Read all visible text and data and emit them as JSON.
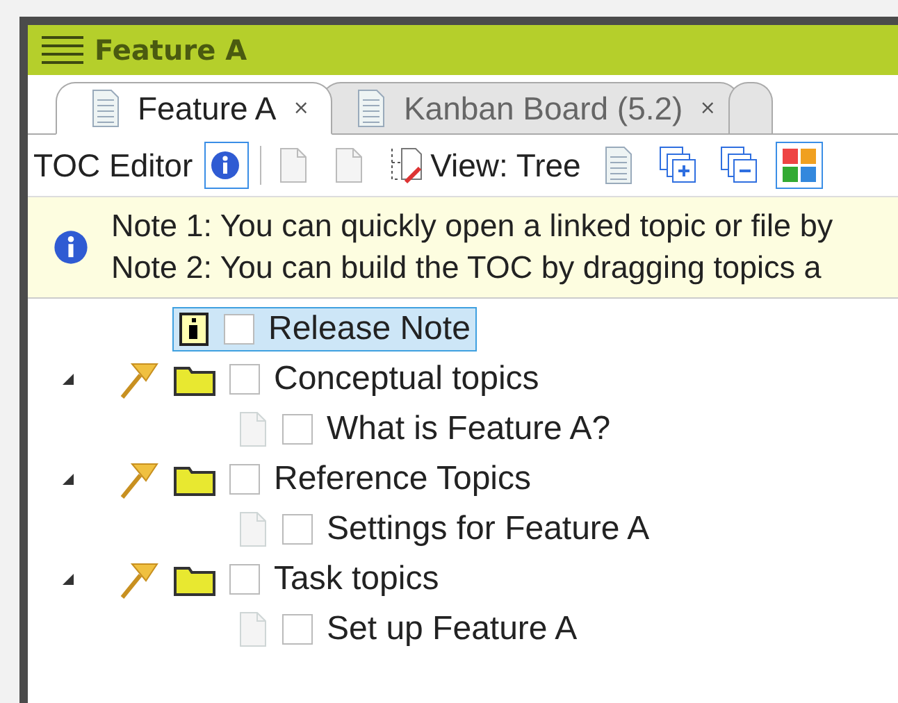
{
  "window": {
    "title": "Feature A"
  },
  "tabs": [
    {
      "label": "Feature A",
      "close": "×",
      "selected": true
    },
    {
      "label": "Kanban Board (5.2)",
      "close": "×",
      "selected": false
    }
  ],
  "toolbar": {
    "label": "TOC Editor",
    "view": "View: Tree"
  },
  "notes": [
    "Note 1: You can quickly open a linked topic or file by",
    "Note 2: You can build the TOC by dragging topics a"
  ],
  "tree": [
    {
      "label": "Release Note",
      "kind": "note",
      "selected": true,
      "checked": false
    },
    {
      "label": "Conceptual topics",
      "kind": "folder",
      "selected": false,
      "checked": false,
      "expanded": true,
      "children": [
        {
          "label": "What is Feature A?",
          "kind": "topic",
          "selected": false,
          "checked": false
        }
      ]
    },
    {
      "label": "Reference Topics",
      "kind": "folder",
      "selected": false,
      "checked": false,
      "expanded": true,
      "children": [
        {
          "label": "Settings for Feature A",
          "kind": "topic",
          "selected": false,
          "checked": false
        }
      ]
    },
    {
      "label": "Task topics",
      "kind": "folder",
      "selected": false,
      "checked": false,
      "expanded": true,
      "children": [
        {
          "label": "Set up Feature A",
          "kind": "topic",
          "selected": false,
          "checked": false
        }
      ]
    }
  ]
}
